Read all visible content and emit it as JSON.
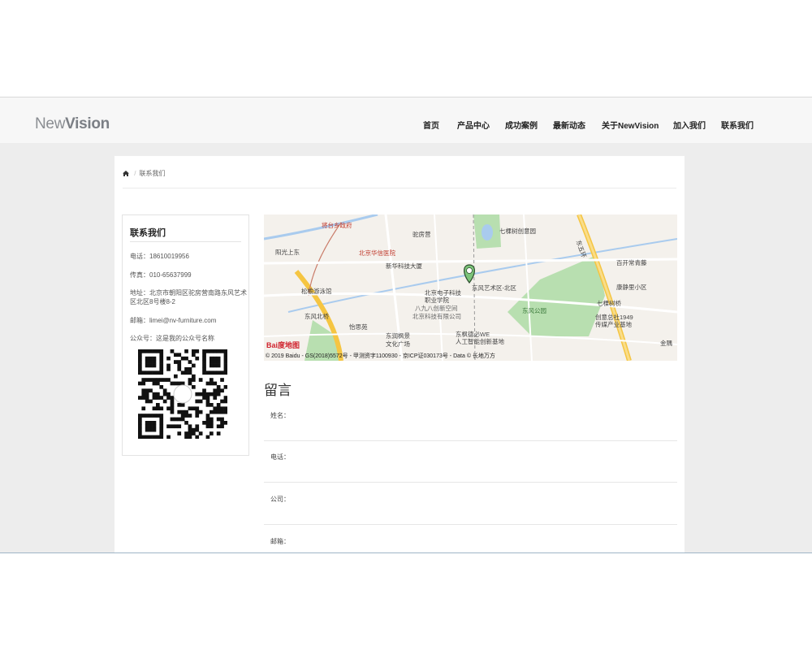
{
  "header": {
    "logo_light": "New",
    "logo_bold": "Vision",
    "nav": [
      "首页",
      "产品中心",
      "成功案例",
      "最新动态",
      "关于NewVision",
      "加入我们",
      "联系我们"
    ]
  },
  "breadcrumb": {
    "home_icon": "home-icon",
    "current": "联系我们"
  },
  "sidebar": {
    "title": "联系我们",
    "phone": "电话：18610019956",
    "fax": "传真：010-65637999",
    "address": "地址：北京市朝阳区驼房营南路东风艺术区北区8号楼8-2",
    "email": "邮箱：limei@nv-furniture.com",
    "wechat": "公众号：这是我的公众号名称",
    "qr_icon": "qr-code-icon"
  },
  "map": {
    "labels": [
      "将台乡政府",
      "驼房营",
      "七棵树创意园",
      "阳光上东",
      "北京华信医院",
      "新华科技大厦",
      "百开常青藤",
      "松榆游泳馆",
      "北京电子科技",
      "职业学院",
      "东风艺术区-北区",
      "康静里小区",
      "八九八创新空间",
      "北京科技有限公司",
      "东风公园",
      "七棵树桥",
      "东风北桥",
      "创意总社1949",
      "传媒产业基地",
      "怡思苑",
      "东润枫景",
      "文化广场",
      "东枫德必WE",
      "人工智能创新基地",
      "金隅",
      "东五环"
    ],
    "copyright": "© 2019 Baidu - GS(2018)5572号 - 甲测资字1100930 - 京ICP证030173号 - Data © 长地万方",
    "brand": "Bai度地图",
    "marker_icon": "map-pin-icon",
    "colors": {
      "park": "#b8dfb0",
      "road_main": "#f5c542",
      "water": "#a9cbee",
      "land": "#f4f1ec"
    }
  },
  "message": {
    "title": "留言",
    "fields": [
      "姓名：",
      "电话：",
      "公司：",
      "邮箱："
    ]
  }
}
